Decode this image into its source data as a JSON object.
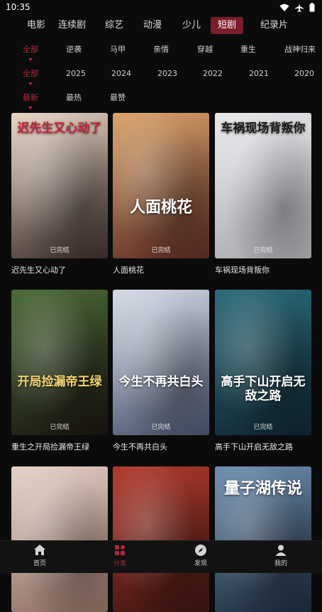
{
  "status": {
    "time": "10:35"
  },
  "nav_tabs": [
    "电影",
    "连续剧",
    "综艺",
    "动漫",
    "少儿",
    "短剧",
    "纪录片"
  ],
  "active_tab": "短剧",
  "filters": {
    "genre": [
      "全部",
      "逆袭",
      "马甲",
      "亲情",
      "穿越",
      "重生",
      "战神归来"
    ],
    "year": [
      "全部",
      "2025",
      "2024",
      "2023",
      "2022",
      "2021",
      "2020"
    ],
    "sort": [
      "最新",
      "最热",
      "最赞"
    ]
  },
  "selected_filters": {
    "genre": "全部",
    "year": "全部",
    "sort": "最新"
  },
  "items": [
    {
      "title": "迟先生又心动了",
      "poster_text": "迟先生又心动了",
      "badge": "已完结",
      "palette": [
        "#e9d7c6",
        "#3a2c2a"
      ],
      "text_color": "#c8203b"
    },
    {
      "title": "人面桃花",
      "poster_text": "人面桃花",
      "badge": "已完结",
      "palette": [
        "#d9a36a",
        "#5a2a23"
      ],
      "text_color": "#ffffff"
    },
    {
      "title": "车祸现场背叛你",
      "poster_text": "车祸现场背叛你",
      "badge": "已完结",
      "palette": [
        "#e6e8ea",
        "#a7a9ad"
      ],
      "text_color": "#1a1a1a"
    },
    {
      "title": "重生之开局捡漏帝王绿",
      "poster_text": "开局捡漏帝王绿",
      "badge": "已完结",
      "palette": [
        "#4b6a38",
        "#1a1410"
      ],
      "text_color": "#f3d46c"
    },
    {
      "title": "今生不再共白头",
      "poster_text": "今生不再共白头",
      "badge": "已完结",
      "palette": [
        "#d7dce8",
        "#46506a"
      ],
      "text_color": "#ffffff"
    },
    {
      "title": "高手下山开启无敌之路",
      "poster_text": "高手下山开启无敌之路",
      "badge": "已完结",
      "palette": [
        "#2c6c7a",
        "#0f2430"
      ],
      "text_color": "#ffffff"
    },
    {
      "title": "",
      "poster_text": "",
      "badge": "",
      "palette": [
        "#e4d1c7",
        "#8d6b5f"
      ],
      "text_color": "#ffffff"
    },
    {
      "title": "",
      "poster_text": "",
      "badge": "",
      "palette": [
        "#b23a2c",
        "#3b1410"
      ],
      "text_color": "#ffffff"
    },
    {
      "title": "",
      "poster_text": "量子湖传说",
      "badge": "",
      "palette": [
        "#6f8fb0",
        "#1c2a3b"
      ],
      "text_color": "#ffffff"
    }
  ],
  "bottom_nav": [
    {
      "label": "首页",
      "icon": "home-icon"
    },
    {
      "label": "分类",
      "icon": "grid-icon"
    },
    {
      "label": "发现",
      "icon": "compass-icon"
    },
    {
      "label": "我的",
      "icon": "user-icon"
    }
  ],
  "active_bottom": "分类",
  "colors": {
    "accent": "#b12a3b",
    "active_tab_bg": "#7a1e2a",
    "background": "#0b0b0b"
  }
}
